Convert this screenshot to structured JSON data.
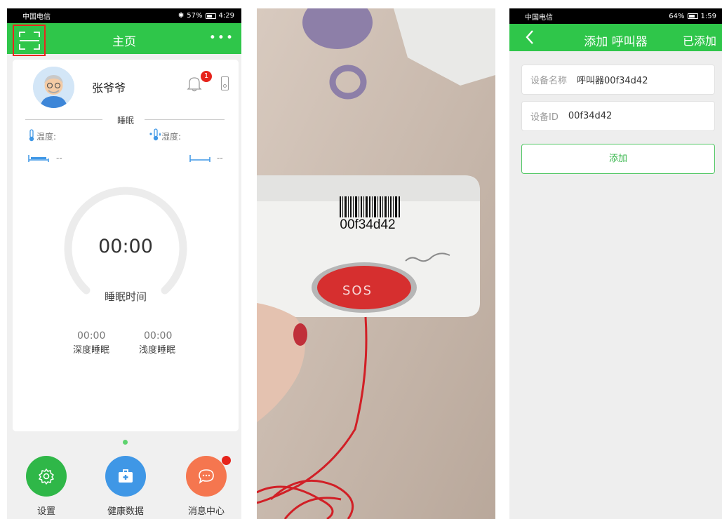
{
  "left_screen": {
    "status_bar": {
      "carrier": "中国电信",
      "battery": "57%",
      "time": "4:29"
    },
    "header": {
      "title": "主页",
      "more": "•••"
    },
    "user": {
      "name": "张爷爷"
    },
    "notifications": {
      "count": "1"
    },
    "sleep_section": {
      "label": "睡眠",
      "temperature_label": "温度:",
      "humidity_label": "湿度:",
      "bed_left_value": "--",
      "bed_right_value": "--"
    },
    "sleep_timer": {
      "time": "00:00",
      "label": "睡眠时间",
      "deep_sleep_time": "00:00",
      "deep_sleep_label": "深度睡眠",
      "light_sleep_time": "00:00",
      "light_sleep_label": "浅度睡眠"
    },
    "actions": [
      {
        "label": "设置",
        "color": "#2fb748",
        "icon": "gear-icon"
      },
      {
        "label": "健康数据",
        "color": "#3f97e6",
        "icon": "medical-kit-icon"
      },
      {
        "label": "消息中心",
        "color": "#f5764f",
        "icon": "chat-bubble-icon"
      }
    ],
    "accent_color": "#2fc64a"
  },
  "photo": {
    "barcode_text": "00f34d42",
    "button_text": "SOS"
  },
  "right_screen": {
    "status_bar": {
      "carrier": "中国电信",
      "battery": "64%",
      "time": "1:59"
    },
    "header": {
      "title": "添加 呼叫器",
      "right_action": "已添加"
    },
    "fields": {
      "device_name_label": "设备名称",
      "device_name_value": "呼叫器00f34d42",
      "device_id_label": "设备ID",
      "device_id_value": "00f34d42"
    },
    "add_button": "添加"
  }
}
